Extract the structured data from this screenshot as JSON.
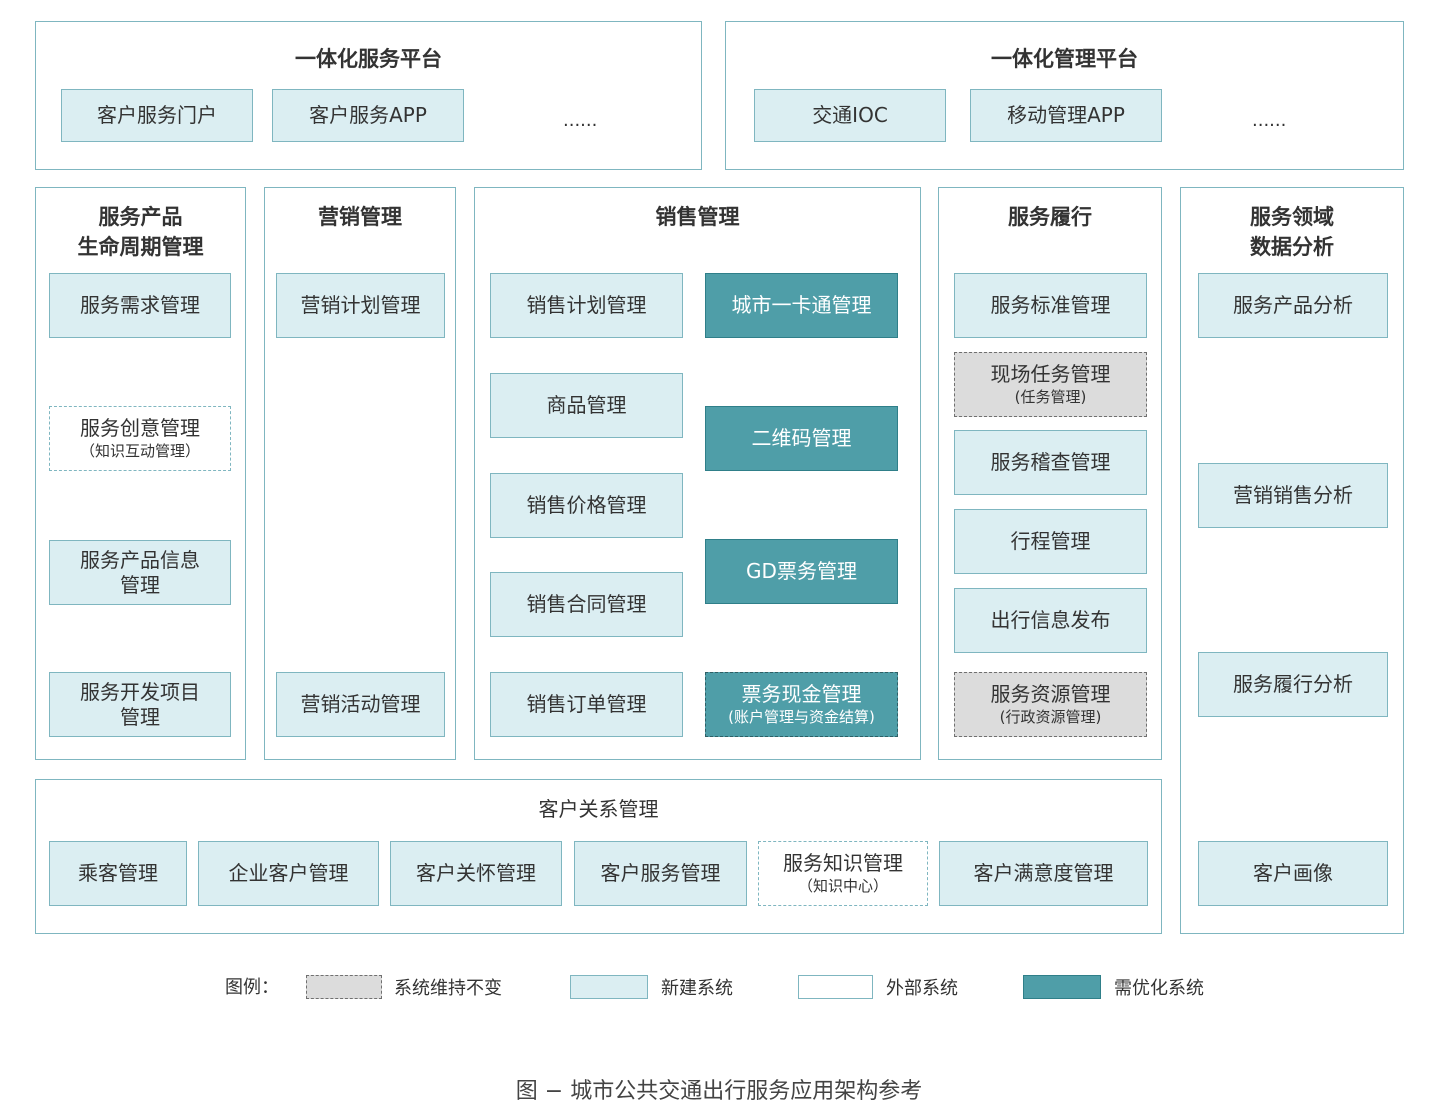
{
  "top": {
    "service_platform": {
      "title": "一体化服务平台",
      "items": [
        "客户服务门户",
        "客户服务APP"
      ],
      "more": "......"
    },
    "management_platform": {
      "title": "一体化管理平台",
      "items": [
        "交通IOC",
        "移动管理APP"
      ],
      "more": "......"
    }
  },
  "columns": {
    "lifecycle": {
      "title_line1": "服务产品",
      "title_line2": "生命周期管理",
      "b1": "服务需求管理",
      "b2_main": "服务创意管理",
      "b2_sub": "（知识互动管理）",
      "b3_l1": "服务产品信息",
      "b3_l2": "管理",
      "b4_l1": "服务开发项目",
      "b4_l2": "管理"
    },
    "marketing": {
      "title": "营销管理",
      "b1": "营销计划管理",
      "b2": "营销活动管理"
    },
    "sales": {
      "title": "销售管理",
      "left": [
        "销售计划管理",
        "商品管理",
        "销售价格管理",
        "销售合同管理",
        "销售订单管理"
      ],
      "r1": "城市一卡通管理",
      "r2": "二维码管理",
      "r3": "GD票务管理",
      "r4_main": "票务现金管理",
      "r4_sub": "(账户管理与资金结算)"
    },
    "fulfillment": {
      "title": "服务履行",
      "b1": "服务标准管理",
      "b2_main": "现场任务管理",
      "b2_sub": "(任务管理)",
      "b3": "服务稽查管理",
      "b4": "行程管理",
      "b5": "出行信息发布",
      "b6_main": "服务资源管理",
      "b6_sub": "(行政资源管理)"
    },
    "analytics": {
      "title_line1": "服务领域",
      "title_line2": "数据分析",
      "b1": "服务产品分析",
      "b2": "营销销售分析",
      "b3": "服务履行分析",
      "b4": "客户画像"
    }
  },
  "crm": {
    "title": "客户关系管理",
    "b1": "乘客管理",
    "b2": "企业客户管理",
    "b3": "客户关怀管理",
    "b4": "客户服务管理",
    "b5_main": "服务知识管理",
    "b5_sub": "（知识中心）",
    "b6": "客户满意度管理"
  },
  "legend": {
    "label": "图例：",
    "keep": "系统维持不变",
    "new": "新建系统",
    "external": "外部系统",
    "optimize": "需优化系统"
  },
  "colors": {
    "new_fill": "#dbeef2",
    "optimize_fill": "#4f9ea8",
    "keep_fill": "#dcdcdc",
    "border": "#7fb6c0"
  },
  "caption": "图 − 城市公共交通出行服务应用架构参考"
}
